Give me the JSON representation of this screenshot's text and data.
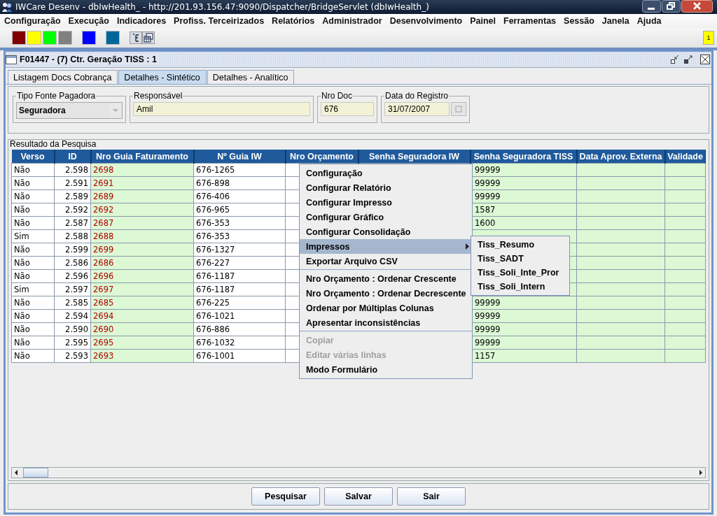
{
  "window": {
    "title": "IWCare Desenv - dbIwHealth_ - http://201.93.156.47:9090/Dispatcher/BridgeServlet (dbIwHealth_)"
  },
  "menu_bar": [
    "Configuração",
    "Execução",
    "Indicadores",
    "Profiss. Terceirizados",
    "Relatórios",
    "Administrador",
    "Desenvolvimento",
    "Painel",
    "Ferramentas",
    "Sessão",
    "Janela",
    "Ajuda"
  ],
  "toolbar": {
    "badge": "1"
  },
  "internal_frame": {
    "title": "F01447 - (7) Ctr. Geração TISS : 1"
  },
  "tabs": [
    {
      "label": "Listagem Docs Cobrança",
      "selected": false
    },
    {
      "label": "Detalhes - Sintético",
      "selected": true
    },
    {
      "label": "Detalhes - Analítico",
      "selected": false
    }
  ],
  "filters": [
    {
      "label": "Tipo Fonte Pagadora",
      "value": "Seguradora",
      "kind": "combo"
    },
    {
      "label": "Responsável",
      "value": "Amil",
      "kind": "text"
    },
    {
      "label": "Nro Doc",
      "value": "676",
      "kind": "text"
    },
    {
      "label": "Data do Registro",
      "value": "31/07/2007",
      "kind": "date"
    }
  ],
  "results": {
    "title": "Resultado da Pesquisa",
    "columns": [
      "Verso",
      "ID",
      "Nro Guia Faturamento",
      "Nº Guia IW",
      "Nro Orçamento",
      "Senha Seguradora IW",
      "Senha Seguradora TISS",
      "Data Aprov. Externa",
      "Validade"
    ],
    "rows": [
      {
        "verso": "Não",
        "id": "2.598",
        "nro_guia_faturamento": "2698",
        "n_guia_iw": "676-1265",
        "senha_seguradora_tiss": "99999"
      },
      {
        "verso": "Não",
        "id": "2.591",
        "nro_guia_faturamento": "2691",
        "n_guia_iw": "676-898",
        "senha_seguradora_tiss": "99999"
      },
      {
        "verso": "Não",
        "id": "2.589",
        "nro_guia_faturamento": "2689",
        "n_guia_iw": "676-406",
        "senha_seguradora_tiss": "99999"
      },
      {
        "verso": "Não",
        "id": "2.592",
        "nro_guia_faturamento": "2692",
        "n_guia_iw": "676-965",
        "senha_seguradora_tiss": "1587"
      },
      {
        "verso": "Não",
        "id": "2.587",
        "nro_guia_faturamento": "2687",
        "n_guia_iw": "676-353",
        "senha_seguradora_tiss": "1600"
      },
      {
        "verso": "Sim",
        "id": "2.588",
        "nro_guia_faturamento": "2688",
        "n_guia_iw": "676-353"
      },
      {
        "verso": "Não",
        "id": "2.599",
        "nro_guia_faturamento": "2699",
        "n_guia_iw": "676-1327"
      },
      {
        "verso": "Não",
        "id": "2.586",
        "nro_guia_faturamento": "2686",
        "n_guia_iw": "676-227"
      },
      {
        "verso": "Não",
        "id": "2.596",
        "nro_guia_faturamento": "2696",
        "n_guia_iw": "676-1187"
      },
      {
        "verso": "Sim",
        "id": "2.597",
        "nro_guia_faturamento": "2697",
        "n_guia_iw": "676-1187"
      },
      {
        "verso": "Não",
        "id": "2.585",
        "nro_guia_faturamento": "2685",
        "n_guia_iw": "676-225",
        "senha_seguradora_tiss": "99999"
      },
      {
        "verso": "Não",
        "id": "2.594",
        "nro_guia_faturamento": "2694",
        "n_guia_iw": "676-1021",
        "senha_seguradora_tiss": "99999"
      },
      {
        "verso": "Não",
        "id": "2.590",
        "nro_guia_faturamento": "2690",
        "n_guia_iw": "676-886",
        "senha_seguradora_tiss": "99999"
      },
      {
        "verso": "Não",
        "id": "2.595",
        "nro_guia_faturamento": "2695",
        "n_guia_iw": "676-1032",
        "senha_seguradora_tiss": "99999"
      },
      {
        "verso": "Não",
        "id": "2.593",
        "nro_guia_faturamento": "2693",
        "n_guia_iw": "676-1001",
        "senha_seguradora_tiss": "1157"
      }
    ]
  },
  "context_menu": {
    "items": [
      {
        "label": "Configuração",
        "kind": "item",
        "disabled": false,
        "selected": false
      },
      {
        "label": "Configurar Relatório",
        "kind": "item",
        "disabled": false,
        "selected": false
      },
      {
        "label": "Configurar Impresso",
        "kind": "item",
        "disabled": false,
        "selected": false
      },
      {
        "label": "Configurar Gráfico",
        "kind": "item",
        "disabled": false,
        "selected": false
      },
      {
        "label": "Configurar Consolidação",
        "kind": "item",
        "disabled": false,
        "selected": false
      },
      {
        "label": "Impressos",
        "kind": "submenu",
        "disabled": false,
        "selected": true
      },
      {
        "label": "Exportar Arquivo CSV",
        "kind": "item",
        "disabled": false,
        "selected": false
      },
      {
        "kind": "separator"
      },
      {
        "label": "Nro Orçamento : Ordenar Crescente",
        "kind": "item",
        "disabled": false,
        "selected": false
      },
      {
        "label": "Nro Orçamento : Ordenar Decrescente",
        "kind": "item",
        "disabled": false,
        "selected": false
      },
      {
        "label": "Ordenar por Múltiplas Colunas",
        "kind": "item",
        "disabled": false,
        "selected": false
      },
      {
        "label": "Apresentar inconsistências",
        "kind": "item",
        "disabled": false,
        "selected": false
      },
      {
        "kind": "separator"
      },
      {
        "label": "Copiar",
        "kind": "item",
        "disabled": true,
        "selected": false
      },
      {
        "label": "Editar várias linhas",
        "kind": "item",
        "disabled": true,
        "selected": false
      },
      {
        "label": "Modo Formulário",
        "kind": "item",
        "disabled": false,
        "selected": false
      }
    ],
    "submenu": [
      "Tiss_Resumo",
      "Tiss_SADT",
      "Tiss_Soli_Inte_Pror",
      "Tiss_Soli_Intern"
    ]
  },
  "buttons": [
    "Pesquisar",
    "Salvar",
    "Sair"
  ]
}
